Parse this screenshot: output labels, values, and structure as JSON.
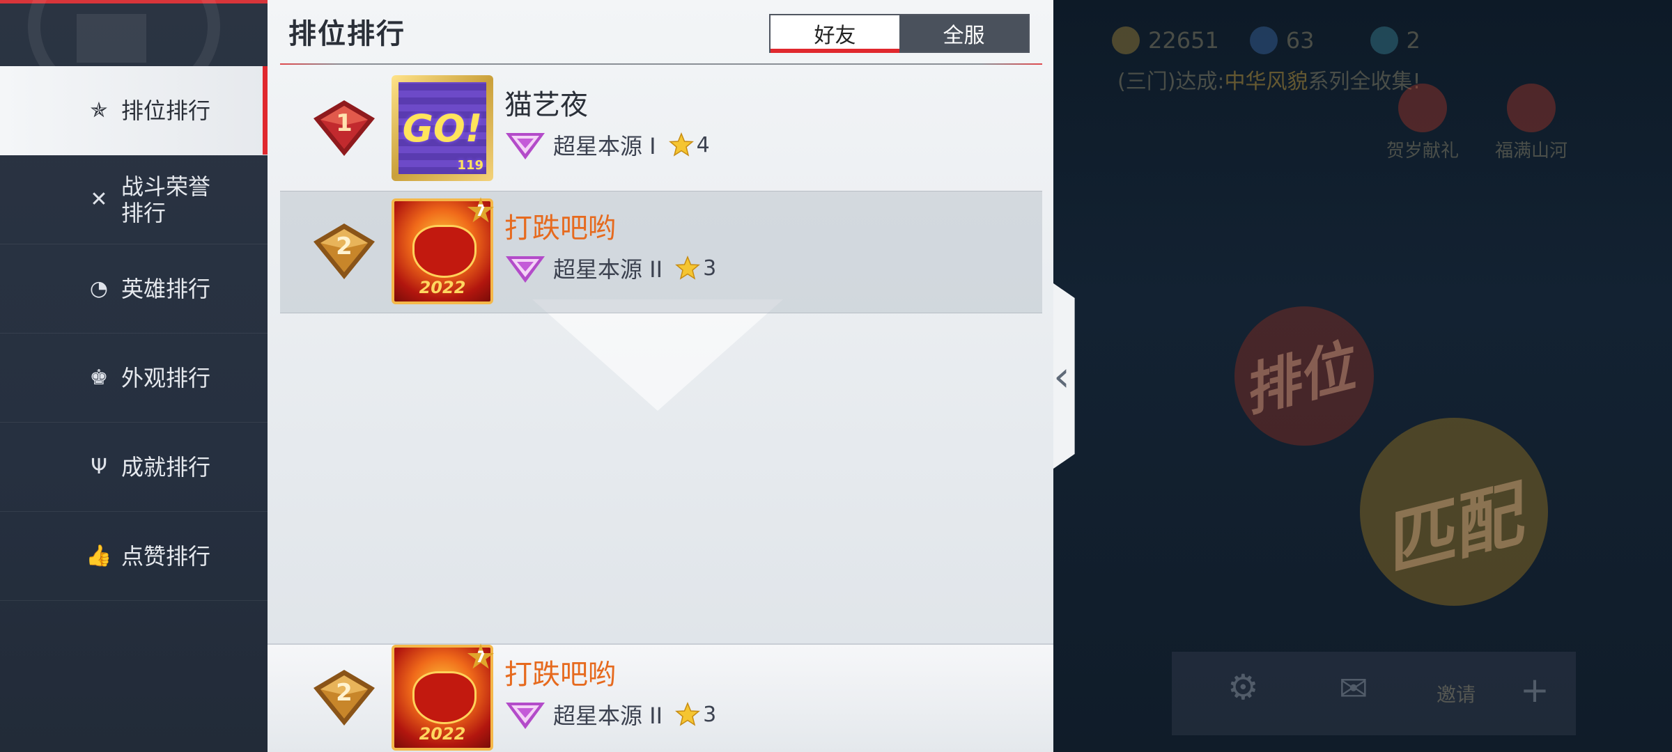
{
  "sidebar": {
    "items": [
      {
        "label": "排位排行",
        "icon": "crown-star-icon",
        "active": true
      },
      {
        "label": "战斗荣誉排行",
        "icon": "crossed-swords-icon",
        "active": false
      },
      {
        "label": "英雄排行",
        "icon": "hero-icon",
        "active": false
      },
      {
        "label": "外观排行",
        "icon": "shirt-icon",
        "active": false
      },
      {
        "label": "成就排行",
        "icon": "trophy-icon",
        "active": false
      },
      {
        "label": "点赞排行",
        "icon": "thumbs-up-icon",
        "active": false
      }
    ]
  },
  "panel": {
    "title": "排位排行",
    "tabs": [
      {
        "label": "好友",
        "selected": true
      },
      {
        "label": "全服",
        "selected": false
      }
    ],
    "entries": [
      {
        "rank": "1",
        "name": "猫艺夜",
        "tier": "超星本源 I",
        "stars": "4",
        "avatar": "go-pixel-avatar",
        "avatar_text": "GO!",
        "avatar_level": "119",
        "badge_color": "#b8262a"
      },
      {
        "rank": "2",
        "name": "打跌吧哟",
        "tier": "超星本源 II",
        "stars": "3",
        "avatar": "lion-dance-avatar",
        "avatar_year": "2022",
        "avatar_badge": "7",
        "badge_color": "#c8862a"
      }
    ],
    "self": {
      "rank": "2",
      "name": "打跌吧哟",
      "tier": "超星本源 II",
      "stars": "3",
      "avatar_year": "2022",
      "avatar_badge": "7"
    }
  },
  "lobby": {
    "currency": [
      {
        "icon": "coin-icon",
        "value": "22651"
      },
      {
        "icon": "gem-plus-icon",
        "value": "63"
      },
      {
        "icon": "ticket-plus-icon",
        "value": "2"
      }
    ],
    "notice_prefix": "(三门)达成:",
    "notice_highlight": "中华风貌",
    "notice_suffix": "系列全收集!",
    "events": [
      {
        "label": "贺岁献礼",
        "icon": "lion-head-icon"
      },
      {
        "label": "福满山河",
        "icon": "lion-head-icon"
      }
    ],
    "modes": [
      {
        "label": "排位"
      },
      {
        "label": "匹配"
      }
    ],
    "bottom": {
      "invite_label": "邀请",
      "settings_icon": "gear-icon",
      "mail_icon": "mail-icon",
      "add_icon": "plus-icon"
    }
  },
  "colors": {
    "accent_red": "#e0282e",
    "name_orange": "#e66a1e"
  }
}
